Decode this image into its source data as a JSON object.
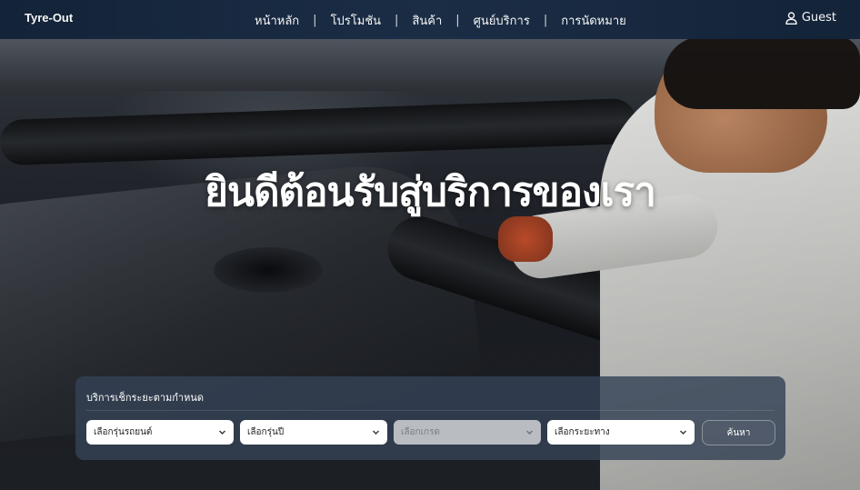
{
  "navbar": {
    "brand": "Tyre-Out",
    "links": [
      {
        "label": "หน้าหลัก"
      },
      {
        "label": "โปรโมชัน"
      },
      {
        "label": "สินค้า"
      },
      {
        "label": "ศูนย์บริการ"
      },
      {
        "label": "การนัดหมาย"
      }
    ],
    "separator": "|",
    "user_label": "Guest",
    "user_icon": "user-icon"
  },
  "hero": {
    "headline": "ยินดีต้อนรับสู่บริการของเรา"
  },
  "search_panel": {
    "title": "บริการเช็กระยะตามกำหนด",
    "selects": [
      {
        "value": "เลือกรุ่นรถยนต์",
        "disabled": false
      },
      {
        "value": "เลือกรุ่นปี",
        "disabled": false
      },
      {
        "value": "เลือกเกรด",
        "disabled": true
      },
      {
        "value": "เลือกระยะทาง",
        "disabled": false
      }
    ],
    "search_label": "ค้นหา"
  },
  "colors": {
    "navbar_bg": "#1a2d46",
    "panel_bg": "#344256",
    "text_primary": "#ffffff",
    "disabled_select_bg": "#b9bcc1"
  }
}
